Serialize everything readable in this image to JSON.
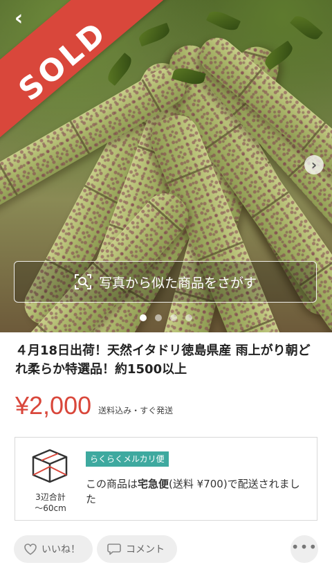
{
  "hero": {
    "sold_label": "SOLD",
    "search_similar_label": "写真から似た商品をさがす",
    "slide_count": 4,
    "active_slide": 1
  },
  "item": {
    "title": "４月18日出荷！天然イタドリ徳島県産 雨上がり朝どれ柔らか特選品！約1500以上",
    "price": "¥2,000",
    "price_note": "送料込み・すぐ発送"
  },
  "shipping": {
    "size_label": "3辺合計\n〜60cm",
    "method_badge": "らくらくメルカリ便",
    "desc_prefix": "この商品は",
    "desc_bold": "宅急便",
    "desc_suffix": "(送料 ¥700)で配送されました"
  },
  "actions": {
    "like_label": "いいね！",
    "comment_label": "コメント"
  },
  "colors": {
    "accent": "#d9473b",
    "badge": "#3ea99f"
  }
}
